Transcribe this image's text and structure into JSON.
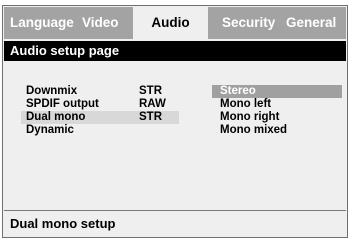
{
  "tabs": [
    {
      "label": "Language"
    },
    {
      "label": "Video"
    },
    {
      "label": "Audio"
    },
    {
      "label": "Security"
    },
    {
      "label": "General"
    }
  ],
  "active_tab": "Audio",
  "page_title": "Audio setup page",
  "settings": [
    {
      "label": "Downmix",
      "value": "STR"
    },
    {
      "label": "SPDIF output",
      "value": "RAW"
    },
    {
      "label": "Dual mono",
      "value": "STR"
    },
    {
      "label": "Dynamic",
      "value": ""
    }
  ],
  "selected_setting": "Dual mono",
  "options": [
    {
      "label": "Stereo"
    },
    {
      "label": "Mono left"
    },
    {
      "label": "Mono right"
    },
    {
      "label": "Mono mixed"
    }
  ],
  "highlighted_option": "Stereo",
  "status_text": "Dual mono setup",
  "colors": {
    "tab_bar": "#a3a3a3",
    "title_bar": "#000000",
    "selection": "#d8d8d8",
    "option_highlight": "#a0a0a0"
  }
}
